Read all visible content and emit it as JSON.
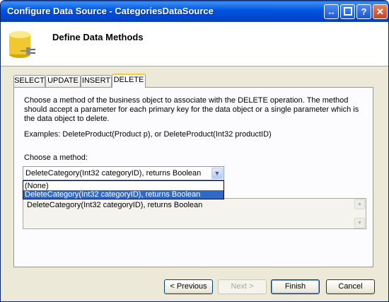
{
  "window": {
    "title": "Configure Data Source - CategoriesDataSource",
    "controls": {
      "restore": "↔",
      "help": "?",
      "close": "✕"
    }
  },
  "header": {
    "title": "Define Data Methods",
    "icon": "database-icon"
  },
  "tabs": [
    {
      "label": "SELECT",
      "active": false
    },
    {
      "label": "UPDATE",
      "active": false
    },
    {
      "label": "INSERT",
      "active": false
    },
    {
      "label": "DELETE",
      "active": true
    }
  ],
  "panel": {
    "description": "Choose a method of the business object to associate with the DELETE operation. The method should accept a parameter for each primary key for the data object or a single parameter which is the data object to delete.",
    "examples": "Examples: DeleteProduct(Product p), or DeleteProduct(Int32 productID)",
    "choose_label": "Choose a method:",
    "method_select": {
      "value": "DeleteCategory(Int32 categoryID), returns Boolean",
      "options": [
        "(None)",
        "DeleteCategory(Int32 categoryID), returns Boolean"
      ],
      "selected_option": "DeleteCategory(Int32 categoryID), returns Boolean"
    },
    "method_signature": "DeleteCategory(Int32 categoryID), returns Boolean"
  },
  "buttons": {
    "previous": "< Previous",
    "next": "Next >",
    "finish": "Finish",
    "cancel": "Cancel"
  },
  "colors": {
    "titlebar": "#0054e3",
    "selection": "#316ac5",
    "tab_highlight": "#ffc83c"
  }
}
